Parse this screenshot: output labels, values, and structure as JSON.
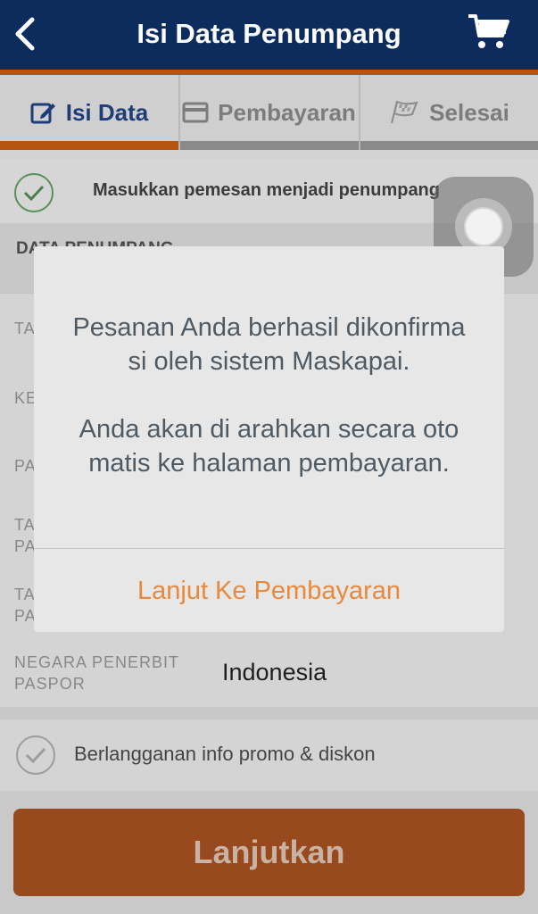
{
  "header": {
    "title": "Isi Data Penumpang"
  },
  "tabs": [
    {
      "label": "Isi Data",
      "icon": "edit-icon",
      "active": true
    },
    {
      "label": "Pembayaran",
      "icon": "credit-card-icon",
      "active": false
    },
    {
      "label": "Selesai",
      "icon": "finish-flag-icon",
      "active": false
    }
  ],
  "form": {
    "passenger_as_booker": "Masukkan pemesan menjadi penumpang",
    "section_title": "DATA PENUMPANG",
    "fields": [
      {
        "label": "TA"
      },
      {
        "label": "KE"
      },
      {
        "label": "PA"
      },
      {
        "label": "TA\nPA"
      },
      {
        "label": "TA\nPA"
      }
    ],
    "issuing_country_label": "NEGARA PENERBIT\nPASPOR",
    "issuing_country_value": "Indonesia",
    "subscribe": "Berlangganan info promo & diskon"
  },
  "modal": {
    "message_line1": "Pesanan Anda berhasil dikonfirma",
    "message_line2": "si oleh sistem Maskapai.",
    "message_line3": "Anda akan di arahkan secara oto",
    "message_line4": "matis ke halaman pembayaran.",
    "button": "Lanjut Ke Pembayaran"
  },
  "footer": {
    "continue_button": "Lanjutkan"
  },
  "colors": {
    "header": "#0b2c5d",
    "accent": "#e8893b",
    "cta": "#98491d"
  }
}
